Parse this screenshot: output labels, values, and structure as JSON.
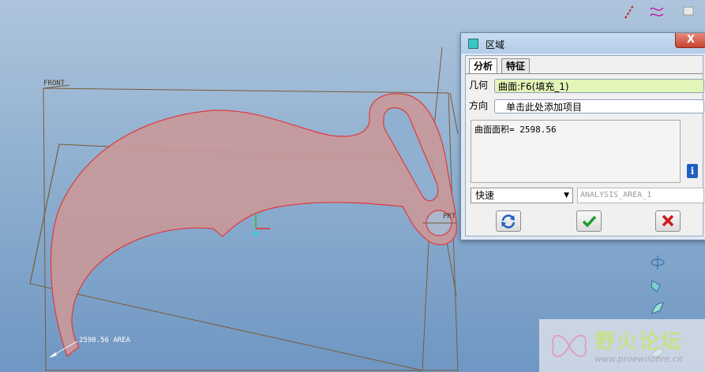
{
  "viewport": {
    "front_label": "FRONT",
    "area_annotation": "2598.56 AREA",
    "prt_label": "PRT"
  },
  "dialog": {
    "title": "区域",
    "close_label": "X",
    "tabs": [
      {
        "label": "分析",
        "active": true
      },
      {
        "label": "特征",
        "active": false
      }
    ],
    "geometry_label": "几何",
    "geometry_value": "曲面:F6(填充_1)",
    "direction_label": "方向",
    "direction_value": "单击此处添加项目",
    "result_text": "曲面面积= 2598.56",
    "info_icon": "i",
    "mode_value": "快速",
    "analysis_name": "ANALYSIS_AREA_1",
    "buttons": {
      "repeat": "repeat-icon",
      "ok": "checkmark-icon",
      "cancel": "cancel-x-icon"
    }
  },
  "watermark": {
    "text": "野火论坛",
    "url": "www.proewildfire.cn"
  },
  "colors": {
    "background_top": "#aec4dc",
    "background_bottom": "#6f97c3",
    "fill_region": "#c8999a",
    "outline": "#e0393d",
    "datum_lines": "#7a5a38",
    "dialog_bg": "#dfe9f5",
    "geometry_field": "#e3f5b8"
  }
}
